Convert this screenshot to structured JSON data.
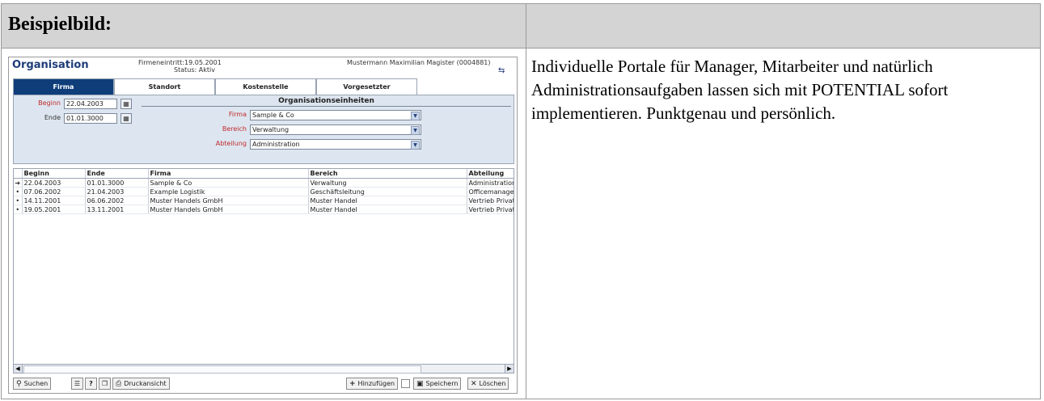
{
  "document": {
    "header_title": "Beispielbild:",
    "description": "Individuelle Portale für Manager, Mitarbeiter und natürlich Administrationsaufgaben lassen sich mit POTENTIAL sofort implementieren. Punktgenau und persönlich."
  },
  "app": {
    "title": "Organisation",
    "entry_date": "Firmeneintritt:19.05.2001",
    "status": "Status: Aktiv",
    "user": "Mustermann Maximilian Magister (0004881)",
    "swap_icon": "swap-arrows-icon",
    "tabs": [
      {
        "label": "Firma",
        "active": true
      },
      {
        "label": "Standort",
        "active": false
      },
      {
        "label": "Kostenstelle",
        "active": false
      },
      {
        "label": "Vorgesetzter",
        "active": false
      }
    ],
    "form": {
      "begin_label": "Beginn",
      "begin_value": "22.04.2003",
      "end_label": "Ende",
      "end_value": "01.01.3000",
      "org_units_heading": "Organisationseinheiten",
      "firma_label": "Firma",
      "firma_value": "Sample & Co",
      "bereich_label": "Bereich",
      "bereich_value": "Verwaltung",
      "abteilung_label": "Abteilung",
      "abteilung_value": "Administration",
      "calendar_icon": "calendar-icon"
    },
    "table": {
      "headers": [
        "Beginn",
        "Ende",
        "Firma",
        "Bereich",
        "Abteilung"
      ],
      "rows": [
        {
          "marker": "➔",
          "cells": [
            "22.04.2003",
            "01.01.3000",
            "Sample & Co",
            "Verwaltung",
            "Administration"
          ]
        },
        {
          "marker": "•",
          "cells": [
            "07.06.2002",
            "21.04.2003",
            "Example Logistik",
            "Geschäftsleitung",
            "Officemanagement"
          ]
        },
        {
          "marker": "•",
          "cells": [
            "14.11.2001",
            "06.06.2002",
            "Muster Handels GmbH",
            "Muster Handel",
            "Vertrieb Privat"
          ]
        },
        {
          "marker": "•",
          "cells": [
            "19.05.2001",
            "13.11.2001",
            "Muster Handels GmbH",
            "Muster Handel",
            "Vertrieb Privat"
          ]
        }
      ]
    },
    "toolbar": {
      "search_label": "Suchen",
      "print_label": "Druckansicht",
      "add_label": "Hinzufügen",
      "save_label": "Speichern",
      "delete_label": "Löschen"
    },
    "colors": {
      "accent": "#0e3d7a",
      "form_background": "#dde6f0",
      "required_label": "#c0282c"
    }
  }
}
